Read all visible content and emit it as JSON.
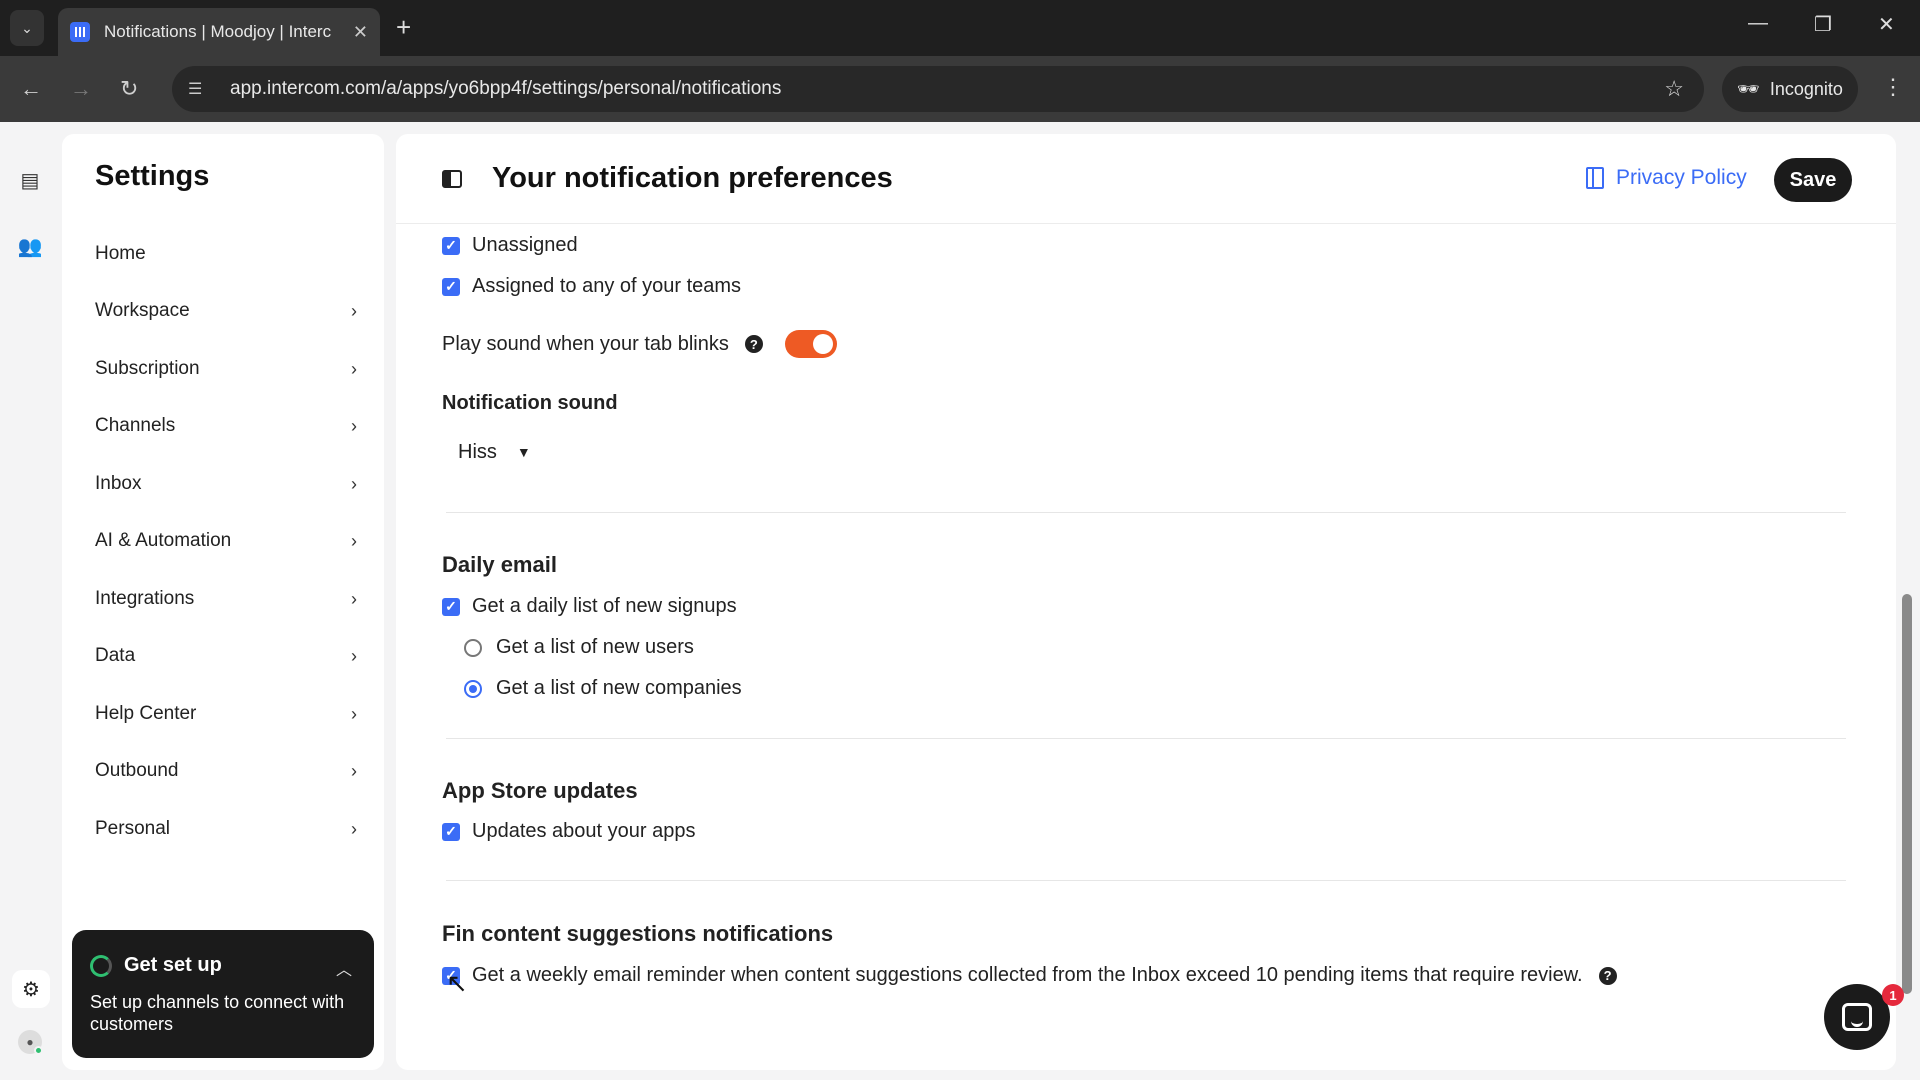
{
  "browser": {
    "tab_title": "Notifications | Moodjoy | Interc",
    "url": "app.intercom.com/a/apps/yo6bpp4f/settings/personal/notifications",
    "profile_label": "Incognito"
  },
  "sidebar": {
    "title": "Settings",
    "items": [
      {
        "label": "Home",
        "has_chevron": false
      },
      {
        "label": "Workspace",
        "has_chevron": true
      },
      {
        "label": "Subscription",
        "has_chevron": true
      },
      {
        "label": "Channels",
        "has_chevron": true
      },
      {
        "label": "Inbox",
        "has_chevron": true
      },
      {
        "label": "AI & Automation",
        "has_chevron": true
      },
      {
        "label": "Integrations",
        "has_chevron": true
      },
      {
        "label": "Data",
        "has_chevron": true
      },
      {
        "label": "Help Center",
        "has_chevron": true
      },
      {
        "label": "Outbound",
        "has_chevron": true
      },
      {
        "label": "Personal",
        "has_chevron": true
      }
    ],
    "setup_card": {
      "title": "Get set up",
      "body": "Set up channels to connect with customers"
    }
  },
  "header": {
    "title": "Your notification preferences",
    "privacy_label": "Privacy Policy",
    "save_label": "Save"
  },
  "content": {
    "unassigned": "Unassigned",
    "assigned_teams": "Assigned to any of your teams",
    "play_sound_label": "Play sound when your tab blinks",
    "play_sound_on": true,
    "notification_sound_title": "Notification sound",
    "notification_sound_value": "Hiss",
    "daily_email_title": "Daily email",
    "daily_signups": "Get a daily list of new signups",
    "new_users": "Get a list of new users",
    "new_companies": "Get a list of new companies",
    "selected_daily_option": "Get a list of new companies",
    "app_store_title": "App Store updates",
    "app_updates": "Updates about your apps",
    "fin_title": "Fin content suggestions notifications",
    "fin_reminder": "Get a weekly email reminder when content suggestions collected from the Inbox exceed 10 pending items that require review."
  },
  "messenger": {
    "badge_count": "1"
  },
  "colors": {
    "accent": "#3b6cf6",
    "toggle_on": "#ee5a24",
    "dark": "#1b1b1b"
  }
}
